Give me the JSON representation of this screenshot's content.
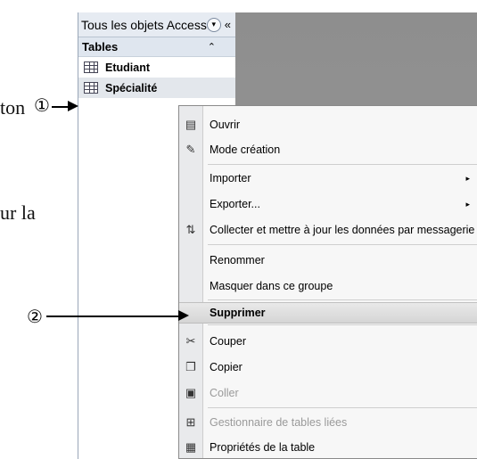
{
  "document": {
    "fragment_1": "ton",
    "fragment_2": "ur la"
  },
  "nav_pane": {
    "title": "Tous les objets Access",
    "dropdown_glyph": "▾",
    "collapse_glyph": "«",
    "group": {
      "label": "Tables",
      "chevron": "⌃"
    },
    "items": [
      {
        "label": "Etudiant"
      },
      {
        "label": "Spécialité"
      }
    ]
  },
  "context_menu": {
    "items": [
      {
        "label": "Ouvrir",
        "icon": "open-table-icon",
        "glyph": "▤"
      },
      {
        "label": "Mode création",
        "icon": "design-view-icon",
        "glyph": "✎"
      },
      {
        "label": "Importer",
        "submenu": "▸"
      },
      {
        "label": "Exporter...",
        "submenu": "▸"
      },
      {
        "label": "Collecter et mettre à jour les données par messagerie",
        "icon": "collect-data-icon",
        "glyph": "⇅"
      },
      {
        "label": "Renommer"
      },
      {
        "label": "Masquer dans ce groupe"
      },
      {
        "label": "Supprimer"
      },
      {
        "label": "Couper",
        "icon": "scissors-icon",
        "glyph": "✂"
      },
      {
        "label": "Copier",
        "icon": "copy-icon",
        "glyph": "❐"
      },
      {
        "label": "Coller",
        "icon": "paste-icon",
        "glyph": "▣"
      },
      {
        "label": "Gestionnaire de tables liées",
        "icon": "linked-table-icon",
        "glyph": "⊞"
      },
      {
        "label": "Propriétés de la table",
        "icon": "properties-icon",
        "glyph": "▦"
      }
    ]
  },
  "callouts": {
    "marker_1": "①",
    "marker_2": "②"
  },
  "colors": {
    "workspace": "#949494",
    "nav_header": "#e6ebf2",
    "menu_background": "#f7f7f7"
  }
}
